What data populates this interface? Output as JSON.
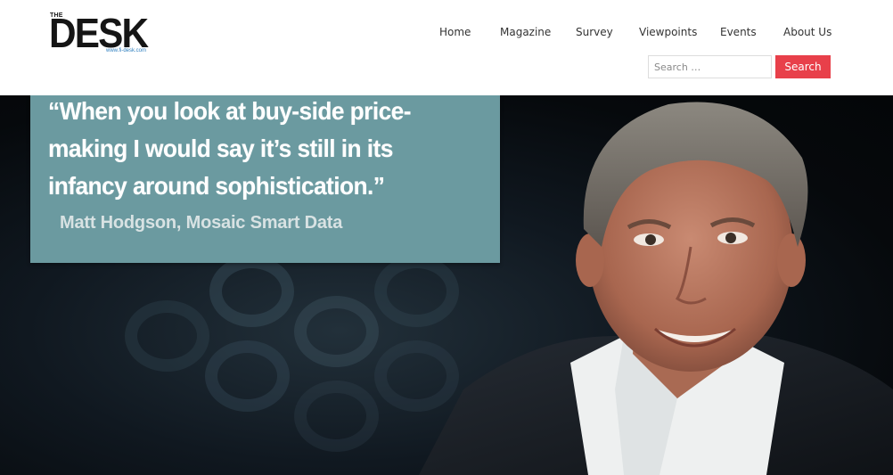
{
  "logo": {
    "small_text": "THE",
    "main_text": "DESK",
    "url_text": "www.fi-desk.com"
  },
  "nav": {
    "items": [
      {
        "label": "Home"
      },
      {
        "label": "Magazine"
      },
      {
        "label": "Survey"
      },
      {
        "label": "Viewpoints"
      },
      {
        "label": "Events"
      },
      {
        "label": "About Us"
      }
    ]
  },
  "search": {
    "placeholder": "Search …",
    "value": "",
    "button_label": "Search",
    "button_color": "#e8404a"
  },
  "hero": {
    "quote": "“When you look at buy-side price-\nmaking I would say it’s still in its\ninfancy around sophistication.”",
    "attribution": "Matt Hodgson, Mosaic Smart Data",
    "quote_box_color": "#6b9aa0",
    "image_subject": "portrait photo of a smiling grey-haired man in a white shirt and dark jacket"
  }
}
